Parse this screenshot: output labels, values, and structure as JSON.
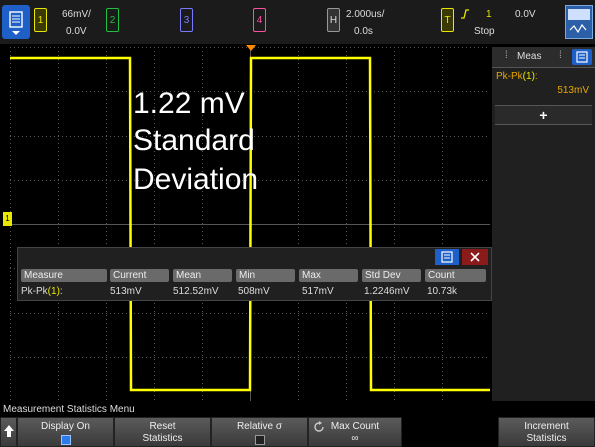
{
  "top": {
    "ch1": {
      "label": "1",
      "scale": "66mV/",
      "offset": "0.0V",
      "color": "#e8e800"
    },
    "ch2": {
      "label": "2",
      "color": "#1fbf3f"
    },
    "ch3": {
      "label": "3",
      "color": "#7a7aff"
    },
    "ch4": {
      "label": "4",
      "color": "#ff4fa0"
    },
    "horiz": {
      "label": "H",
      "scale": "2.000us/",
      "pos": "0.0s"
    },
    "trig": {
      "label": "T",
      "icon": "rising-edge",
      "source": "1",
      "level": "0.0V",
      "mode": "Stop",
      "color": "#e8e800"
    }
  },
  "overlay": {
    "line1": "1.22 mV",
    "line2": "Standard",
    "line3": "Deviation"
  },
  "meas_panel": {
    "title": "Meas",
    "name": "Pk-Pk",
    "src": "(1)",
    "suffix": ":",
    "value": "513mV",
    "add": "+"
  },
  "stats": {
    "headers": [
      "Measure",
      "Current",
      "Mean",
      "Min",
      "Max",
      "Std Dev",
      "Count"
    ],
    "row": {
      "measure": "Pk-Pk",
      "src": "(1)",
      "suffix": ":",
      "current": "513mV",
      "mean": "512.52mV",
      "min": "508mV",
      "max": "517mV",
      "stddev": "1.2246mV",
      "count": "10.73k"
    }
  },
  "menu": {
    "title": "Measurement Statistics Menu",
    "keys": [
      {
        "label": "Display On",
        "sub": ""
      },
      {
        "label": "Reset",
        "sub": "Statistics"
      },
      {
        "label": "Relative σ",
        "sub": ""
      },
      {
        "label": "Max Count",
        "sub": "∞"
      },
      {
        "label": "",
        "sub": ""
      },
      {
        "label": "Increment",
        "sub": "Statistics"
      }
    ]
  },
  "colors": {
    "trace": "#ffff00",
    "grid": "#5a5a5a",
    "accent": "#2a6dd6"
  }
}
